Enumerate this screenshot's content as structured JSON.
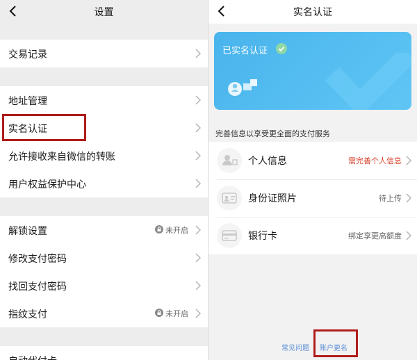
{
  "left": {
    "title": "设置",
    "rows": [
      {
        "label": "交易记录"
      },
      {
        "label": "地址管理"
      },
      {
        "label": "实名认证"
      },
      {
        "label": "允许接收来自微信的转账"
      },
      {
        "label": "用户权益保护中心"
      },
      {
        "label": "解锁设置",
        "status": "未开启"
      },
      {
        "label": "修改支付密码"
      },
      {
        "label": "找回支付密码"
      },
      {
        "label": "指纹支付",
        "status": "未开启"
      },
      {
        "label": "自动代付卡"
      }
    ]
  },
  "right": {
    "title": "实名认证",
    "card": {
      "title": "已实名认证",
      "color": "#49b4ec"
    },
    "hint": "完善信息以享受更全面的支付服务",
    "items": [
      {
        "label": "个人信息",
        "status": "需完善个人信息",
        "icon": "person-id-icon"
      },
      {
        "label": "身份证照片",
        "status": "待上传",
        "icon": "id-card-icon"
      },
      {
        "label": "银行卡",
        "status": "绑定享更高额度",
        "icon": "bank-card-icon"
      }
    ],
    "footer": {
      "faq": "常见问题",
      "rename": "账户更名"
    }
  },
  "colors": {
    "highlight": "#b01c1c",
    "warning": "#d9402b",
    "link": "#5b8ed6"
  }
}
